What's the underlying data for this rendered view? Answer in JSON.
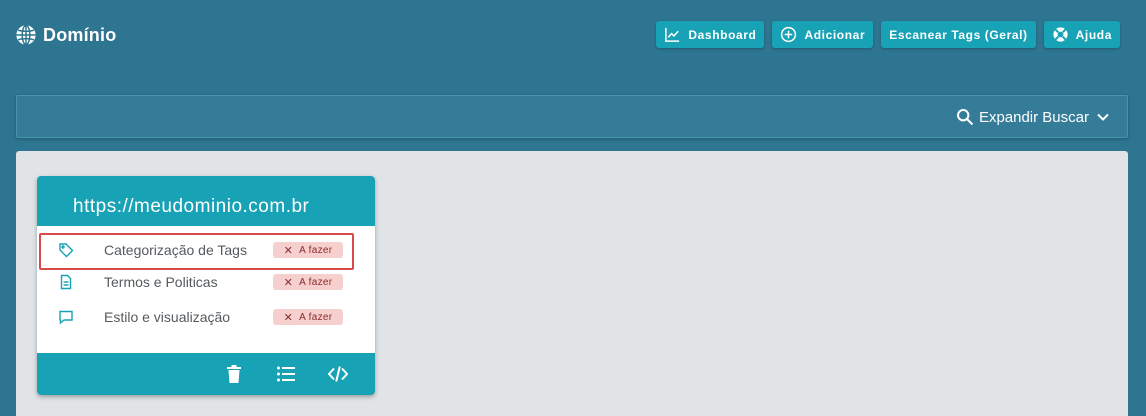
{
  "header": {
    "title": "Domínio",
    "logo_icon": "globe-icon",
    "buttons": [
      {
        "label": "Dashboard",
        "icon": "chart-line-icon"
      },
      {
        "label": "Adicionar",
        "icon": "plus-circle-icon"
      },
      {
        "label": "Escanear Tags (Geral)",
        "icon": ""
      },
      {
        "label": "Ajuda",
        "icon": "lifebuoy-icon"
      }
    ]
  },
  "search": {
    "expand_label": "Expandir Buscar",
    "icon": "search-icon"
  },
  "card": {
    "domain": "https://meudominio.com.br",
    "items": [
      {
        "label": "Categorização de Tags",
        "icon": "tag-icon",
        "status": "A fazer"
      },
      {
        "label": "Termos e Politicas",
        "icon": "document-icon",
        "status": "A fazer"
      },
      {
        "label": "Estilo e visualização",
        "icon": "chat-icon",
        "status": "A fazer"
      }
    ],
    "footer_icons": [
      "trash-icon",
      "list-icon",
      "code-icon"
    ]
  },
  "colors": {
    "background": "#2d7590",
    "accent": "#18a2b5",
    "status_bg": "#f6cfcf",
    "highlight": "#d94a4a"
  }
}
